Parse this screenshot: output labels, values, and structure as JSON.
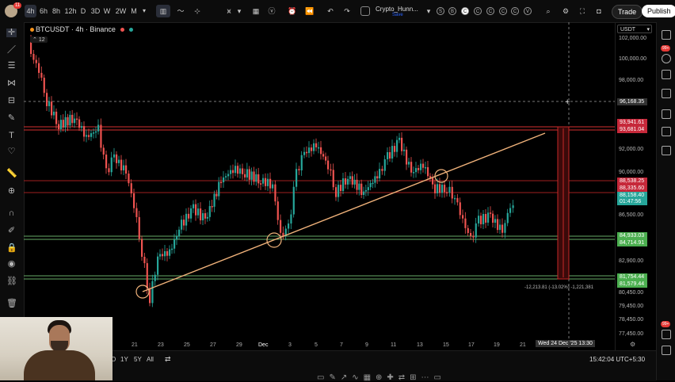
{
  "toolbar": {
    "badge": "11",
    "timeframes": [
      "4h",
      "6h",
      "8h",
      "12h",
      "D",
      "3D",
      "W",
      "2W",
      "M"
    ],
    "selected_timeframe": "4h",
    "layout_name": "Crypto_Hunn...",
    "layout_sub": "Save",
    "circle_letters": [
      "S",
      "B",
      "C",
      "C",
      "C",
      "C",
      "C",
      "V"
    ],
    "trade_label": "Trade",
    "publish_label": "Publish"
  },
  "symbol": {
    "name": "BTCUSDT",
    "interval": "4h",
    "exchange": "Binance",
    "title": "BTCUSDT · 4h · Binance",
    "indicator_count": "12"
  },
  "currency": "USDT",
  "price_axis": {
    "labels": [
      "102,000.00",
      "100,000.00",
      "98,000.00",
      "92,000.00",
      "90,000.00",
      "86,500.00",
      "82,900.00",
      "80,450.00",
      "79,450.00",
      "78,450.00",
      "77,450.00"
    ],
    "crosshair_price": "96,168.35",
    "tags": [
      {
        "value": "93,941.61",
        "color": "#c6283a"
      },
      {
        "value": "93,681.04",
        "color": "#c6283a"
      },
      {
        "value": "88,538.25",
        "color": "#c6283a"
      },
      {
        "value": "88,335.60",
        "color": "#c6283a"
      },
      {
        "value": "88,158.40",
        "color": "#26a69a"
      },
      {
        "value": "01:47:56",
        "color": "#26a69a"
      },
      {
        "value": "84,933.03",
        "color": "#4caf50"
      },
      {
        "value": "84,714.91",
        "color": "#4caf50"
      },
      {
        "value": "81,754.44",
        "color": "#4caf50"
      },
      {
        "value": "81,579.44",
        "color": "#4caf50"
      }
    ]
  },
  "date_axis": {
    "labels": [
      "21",
      "23",
      "25",
      "27",
      "29",
      "Dec",
      "3",
      "5",
      "7",
      "9",
      "11",
      "13",
      "15",
      "17",
      "19",
      "21"
    ],
    "crosshair_date": "Wed 24 Dec '25  13:30"
  },
  "measure_label": "-12,213.81 (-13.02%) -1,221,381",
  "bottom_bar": {
    "ranges": [
      "1D",
      "1Y",
      "5Y",
      "All"
    ],
    "time": "15:42:04 UTC+5:30"
  },
  "right_badges": [
    "99+",
    "99+"
  ],
  "colors": {
    "up": "#26a69a",
    "down": "#ef5350",
    "trendline": "#f0b27a",
    "resistance": "#d32f2f",
    "support": "#4caf50"
  }
}
